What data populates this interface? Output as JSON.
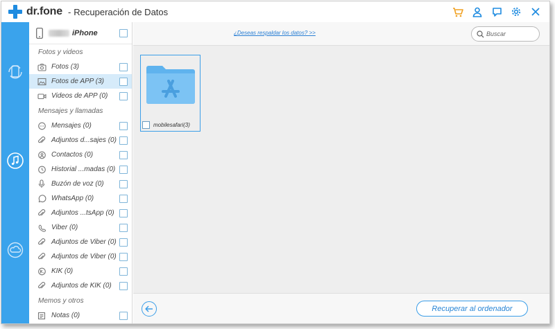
{
  "app": {
    "logo_text": "dr.fone",
    "separator": "-",
    "title": "Recuperación de Datos",
    "brand_color": "#1e8be0",
    "accent_color": "#3aa3ec",
    "cart_color": "#f0a020"
  },
  "title_icons": [
    "cart-icon",
    "user-icon",
    "feedback-icon",
    "settings-icon",
    "close-icon"
  ],
  "rail": [
    "phone-recover-icon",
    "itunes-recover-icon",
    "icloud-recover-icon"
  ],
  "device": {
    "name": "iPhone"
  },
  "categories": [
    {
      "header": "Fotos y videos",
      "items": [
        {
          "label": "Fotos (3)",
          "icon": "camera-icon"
        },
        {
          "label": "Fotos de APP (3)",
          "icon": "image-icon",
          "selected": true
        },
        {
          "label": "Videos de APP (0)",
          "icon": "video-icon"
        }
      ]
    },
    {
      "header": "Mensajes y llamadas",
      "items": [
        {
          "label": "Mensajes (0)",
          "icon": "message-icon"
        },
        {
          "label": "Adjuntos d...sajes (0)",
          "icon": "paperclip-icon"
        },
        {
          "label": "Contactos (0)",
          "icon": "contact-icon"
        },
        {
          "label": "Historial ...madas (0)",
          "icon": "call-history-icon"
        },
        {
          "label": "Buzón de voz (0)",
          "icon": "microphone-icon"
        },
        {
          "label": "WhatsApp (0)",
          "icon": "whatsapp-icon"
        },
        {
          "label": "Adjuntos ...tsApp (0)",
          "icon": "paperclip-icon"
        },
        {
          "label": "Viber (0)",
          "icon": "viber-icon"
        },
        {
          "label": "Adjuntos de Viber (0)",
          "icon": "paperclip-icon"
        },
        {
          "label": "Adjuntos de Viber (0)",
          "icon": "paperclip-icon"
        },
        {
          "label": "KIK (0)",
          "icon": "kik-icon"
        },
        {
          "label": "Adjuntos de KIK (0)",
          "icon": "paperclip-icon"
        }
      ]
    },
    {
      "header": "Memos y otros",
      "items": [
        {
          "label": "Notas (0)",
          "icon": "notes-icon"
        }
      ]
    }
  ],
  "topbar": {
    "backup_link": "¿Deseas respaldar los datos? >>",
    "search_placeholder": "Buscar"
  },
  "folders": [
    {
      "label": "mobilesafari(3)",
      "icon": "app-store-folder-icon"
    }
  ],
  "bottombar": {
    "back_icon": "back-arrow-icon",
    "recover_label": "Recuperar al ordenador"
  }
}
